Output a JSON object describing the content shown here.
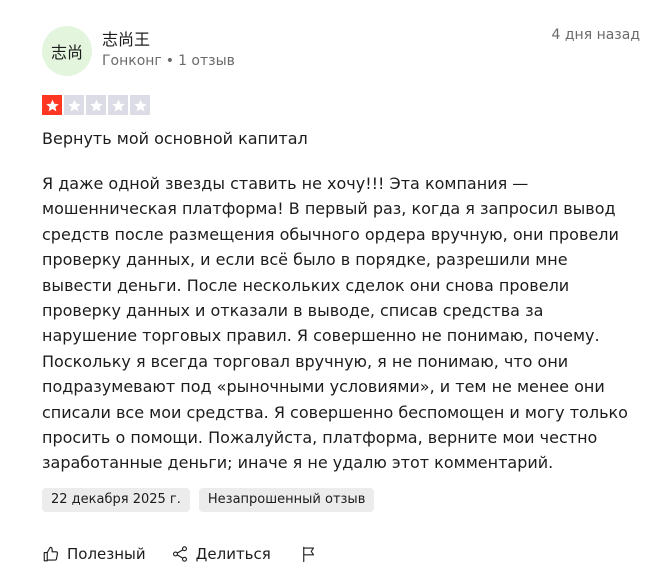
{
  "reviewer": {
    "avatar_text": "志尚",
    "name": "志尚王",
    "country": "Гонконг",
    "separator": "•",
    "review_count": "1 отзыв",
    "date_ago": "4 дня назад"
  },
  "rating": {
    "value": 1,
    "max": 5,
    "filled_color": "#ff3722",
    "empty_color": "#dcdce6"
  },
  "review": {
    "title": "Вернуть мой основной капитал",
    "body": "Я даже одной звезды ставить не хочу!!! Эта компания — мошенническая платформа! В первый раз, когда я запросил вывод средств после размещения обычного ордера вручную, они провели проверку данных, и если всё было в порядке, разрешили мне вывести деньги. После нескольких сделок они снова провели проверку данных и отказали в выводе, списав средства за нарушение торговых правил. Я совершенно не понимаю, почему. Поскольку я всегда торговал вручную, я не понимаю, что они подразумевают под «рыночными условиями», и тем не менее они списали все мои средства. Я совершенно беспомощен и могу только просить о помощи. Пожалуйста, платформа, верните мои честно заработанные деньги; иначе я не удалю этот комментарий."
  },
  "tags": {
    "experience_date": "22 декабря 2025 г.",
    "unprompted": "Незапрошенный отзыв"
  },
  "actions": {
    "helpful_label": "Полезный",
    "share_label": "Делиться",
    "helpful_icon": "thumbs-up-icon",
    "share_icon": "share-icon",
    "report_icon": "flag-icon"
  },
  "colors": {
    "avatar_bg": "#e3f5dd",
    "meta_text": "#6b6b6b",
    "tag_bg": "#ececec"
  }
}
